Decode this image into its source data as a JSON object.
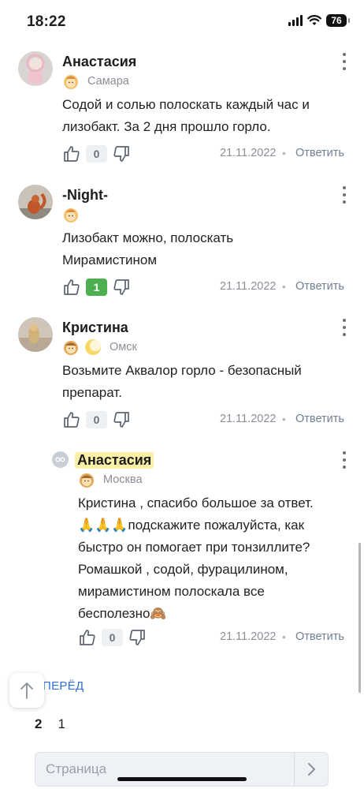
{
  "status": {
    "time": "18:22",
    "battery": "76"
  },
  "comments": [
    {
      "author": "Анастасия",
      "city": "Самара",
      "lines": [
        "Содой и солью полоскать каждый час и",
        "лизобакт. За 2 дня прошло горло."
      ],
      "votes": "0",
      "date": "21.11.2022",
      "reply": "Ответить"
    },
    {
      "author": "-Night-",
      "city": "",
      "lines": [
        "Лизобакт можно, полоскать",
        "Мирамистином"
      ],
      "votes": "1",
      "date": "21.11.2022",
      "reply": "Ответить"
    },
    {
      "author": "Кристина",
      "city": "Омск",
      "lines": [
        "Возьмите Аквалор горло - безопасный",
        "препарат."
      ],
      "votes": "0",
      "date": "21.11.2022",
      "reply": "Ответить"
    },
    {
      "author": "Анастасия",
      "city": "Москва",
      "lines": [
        "Кристина , спасибо большое за ответ.",
        "🙏🙏🙏подскажите пожалуйста, как",
        "быстро он помогает при тонзиллите?",
        "Ромашкой , содой, фурацилином,",
        "мирамистином полоскала все",
        "бесполезно🙈"
      ],
      "votes": "0",
      "date": "21.11.2022",
      "reply": "Ответить"
    }
  ],
  "pagination": {
    "prev_label": "ПЕРЁД",
    "pages": [
      "2",
      "1"
    ],
    "page_placeholder": "Страница"
  },
  "icons": {
    "more": "more-vertical-icon",
    "like": "thumb-up-icon",
    "dislike": "thumb-down-icon",
    "scroll_top": "arrow-up-icon",
    "go": "chevron-right-icon"
  }
}
